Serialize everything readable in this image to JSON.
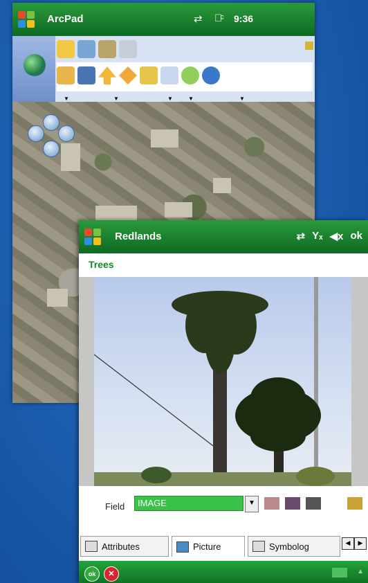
{
  "back_window": {
    "title": "ArcPad",
    "status_time": "9:36",
    "toolbar_icons": [
      "folder-icon",
      "globe-icon",
      "layers-icon",
      "measure-icon",
      "open-folder-icon",
      "save-icon",
      "up-arrow-icon",
      "diamond-icon",
      "pencil-icon",
      "document-icon",
      "refresh-icon",
      "world-icon"
    ]
  },
  "front_window": {
    "title": "Redlands",
    "ok_label": "ok",
    "layer_name": "Trees",
    "field_label": "Field",
    "field_value": "IMAGE",
    "tabs": [
      {
        "label": "Attributes"
      },
      {
        "label": "Picture"
      },
      {
        "label": "Symbolog"
      }
    ],
    "tab_scroll_left": "◀",
    "tab_scroll_right": "▶",
    "bottom_ok": "ok",
    "bottom_cancel": "✕"
  },
  "colors": {
    "title_green": "#1c8a32",
    "accent_green": "#39c24a",
    "layer_green": "#0f8a1f"
  }
}
